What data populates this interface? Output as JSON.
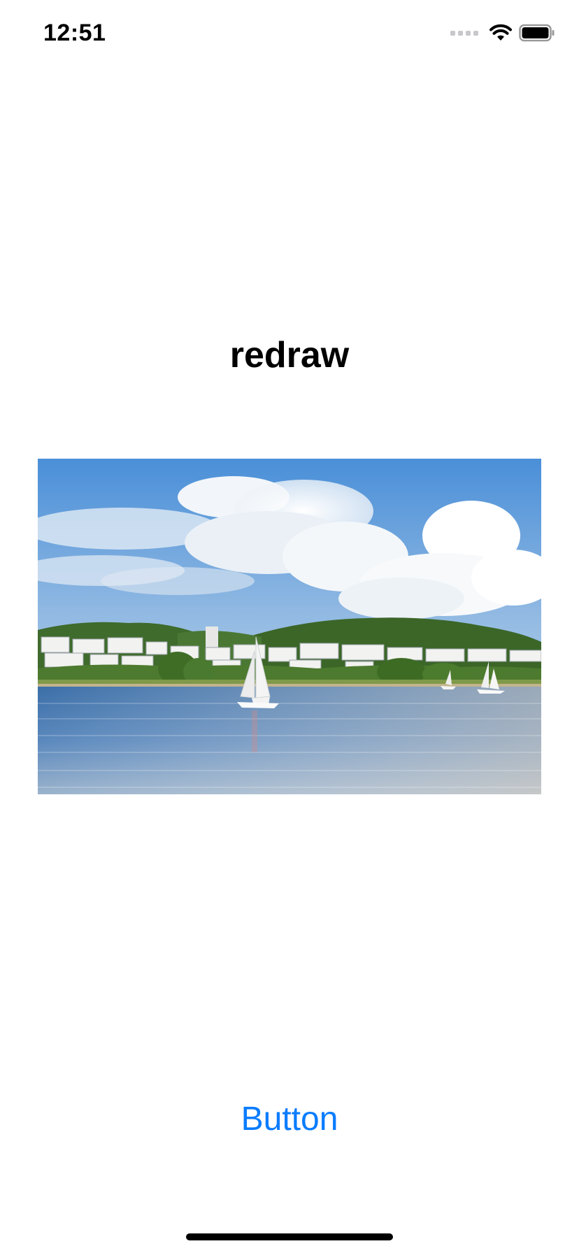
{
  "status_bar": {
    "time": "12:51",
    "icons": [
      "cellular-signal-icon",
      "wifi-icon",
      "battery-icon"
    ]
  },
  "main": {
    "title": "redraw",
    "image_alt": "Lake with sailboats in front of a waterfront housing district under a cloudy blue sky",
    "button_label": "Button"
  },
  "colors": {
    "accent": "#0a7cff",
    "background": "#ffffff",
    "text": "#000000"
  }
}
